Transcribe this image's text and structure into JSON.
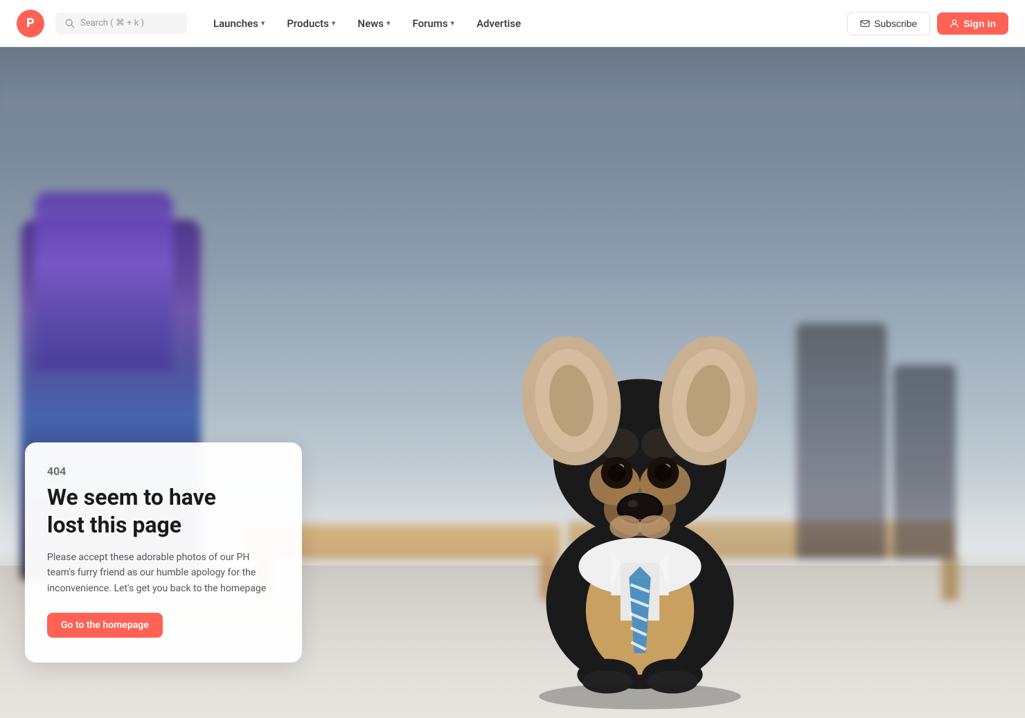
{
  "brand": {
    "logo_letter": "P",
    "logo_color": "#ff6154"
  },
  "nav": {
    "search_placeholder": "Search ( ⌘ + k )",
    "links": [
      {
        "label": "Launches",
        "has_dropdown": true
      },
      {
        "label": "Products",
        "has_dropdown": true
      },
      {
        "label": "News",
        "has_dropdown": true
      },
      {
        "label": "Forums",
        "has_dropdown": true
      },
      {
        "label": "Advertise",
        "has_dropdown": false
      }
    ],
    "subscribe_label": "Subscribe",
    "signin_label": "Sign in"
  },
  "error_page": {
    "code": "404",
    "title_line1": "We seem to have",
    "title_line2": "lost this page",
    "description": "Please accept these adorable photos of our PH team's furry friend as our humble apology for the inconvenience. Let's get you back to the homepage",
    "cta_label": "Go to the homepage"
  }
}
